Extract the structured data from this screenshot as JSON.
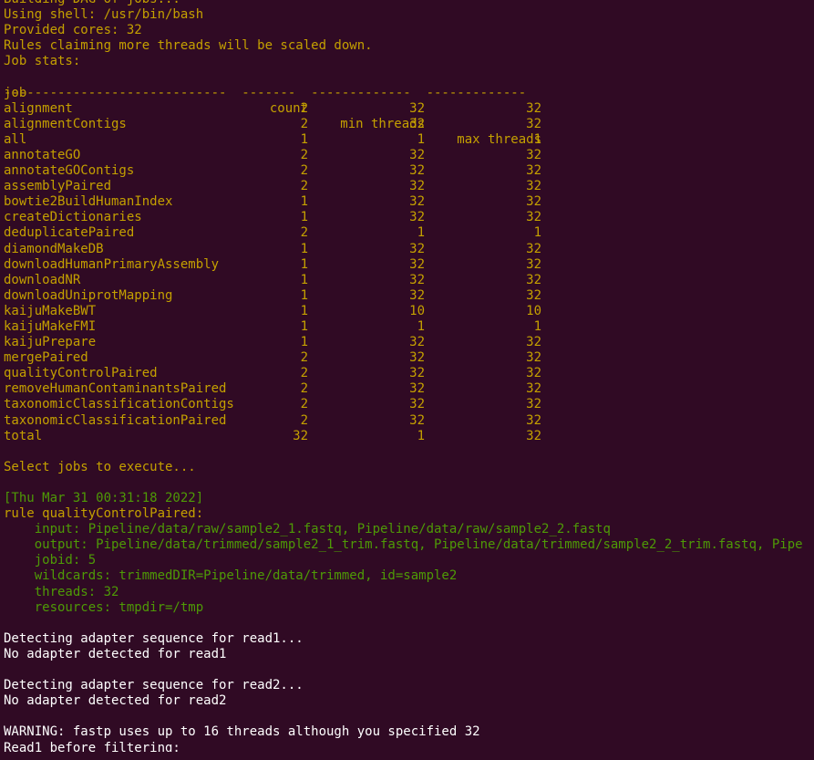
{
  "colors": {
    "background": "#300a24",
    "yellow": "#c4a000",
    "green": "#4e9a06",
    "white": "#ffffff"
  },
  "header_lines": [
    "Building DAG of jobs...",
    "Using shell: /usr/bin/bash",
    "Provided cores: 32",
    "Rules claiming more threads will be scaled down.",
    "Job stats:"
  ],
  "table": {
    "headers": {
      "job": "job",
      "count": "count",
      "min": "min threads",
      "max": "max threads"
    },
    "separator": "-----------------------------  -------  -------------  -------------",
    "rows": [
      {
        "job": "alignment",
        "count": "2",
        "min": "32",
        "max": "32"
      },
      {
        "job": "alignmentContigs",
        "count": "2",
        "min": "32",
        "max": "32"
      },
      {
        "job": "all",
        "count": "1",
        "min": "1",
        "max": "1"
      },
      {
        "job": "annotateGO",
        "count": "2",
        "min": "32",
        "max": "32"
      },
      {
        "job": "annotateGOContigs",
        "count": "2",
        "min": "32",
        "max": "32"
      },
      {
        "job": "assemblyPaired",
        "count": "2",
        "min": "32",
        "max": "32"
      },
      {
        "job": "bowtie2BuildHumanIndex",
        "count": "1",
        "min": "32",
        "max": "32"
      },
      {
        "job": "createDictionaries",
        "count": "1",
        "min": "32",
        "max": "32"
      },
      {
        "job": "deduplicatePaired",
        "count": "2",
        "min": "1",
        "max": "1"
      },
      {
        "job": "diamondMakeDB",
        "count": "1",
        "min": "32",
        "max": "32"
      },
      {
        "job": "downloadHumanPrimaryAssembly",
        "count": "1",
        "min": "32",
        "max": "32"
      },
      {
        "job": "downloadNR",
        "count": "1",
        "min": "32",
        "max": "32"
      },
      {
        "job": "downloadUniprotMapping",
        "count": "1",
        "min": "32",
        "max": "32"
      },
      {
        "job": "kaijuMakeBWT",
        "count": "1",
        "min": "10",
        "max": "10"
      },
      {
        "job": "kaijuMakeFMI",
        "count": "1",
        "min": "1",
        "max": "1"
      },
      {
        "job": "kaijuPrepare",
        "count": "1",
        "min": "32",
        "max": "32"
      },
      {
        "job": "mergePaired",
        "count": "2",
        "min": "32",
        "max": "32"
      },
      {
        "job": "qualityControlPaired",
        "count": "2",
        "min": "32",
        "max": "32"
      },
      {
        "job": "removeHumanContaminantsPaired",
        "count": "2",
        "min": "32",
        "max": "32"
      },
      {
        "job": "taxonomicClassificationContigs",
        "count": "2",
        "min": "32",
        "max": "32"
      },
      {
        "job": "taxonomicClassificationPaired",
        "count": "2",
        "min": "32",
        "max": "32"
      },
      {
        "job": "total",
        "count": "32",
        "min": "1",
        "max": "32"
      }
    ]
  },
  "select_line": "Select jobs to execute...",
  "timestamp": "[Thu Mar 31 00:31:18 2022]",
  "rule": {
    "title": "rule qualityControlPaired:",
    "input": "    input: Pipeline/data/raw/sample2_1.fastq, Pipeline/data/raw/sample2_2.fastq",
    "output": "    output: Pipeline/data/trimmed/sample2_1_trim.fastq, Pipeline/data/trimmed/sample2_2_trim.fastq, Pipe",
    "jobid": "    jobid: 5",
    "wildcards": "    wildcards: trimmedDIR=Pipeline/data/trimmed, id=sample2",
    "threads": "    threads: 32",
    "resources": "    resources: tmpdir=/tmp"
  },
  "output_lines": {
    "detect1": "Detecting adapter sequence for read1...",
    "noadapter1": "No adapter detected for read1",
    "detect2": "Detecting adapter sequence for read2...",
    "noadapter2": "No adapter detected for read2",
    "warning": "WARNING: fastp uses up to 16 threads although you specified 32",
    "read1": "Read1 before filtering:"
  }
}
